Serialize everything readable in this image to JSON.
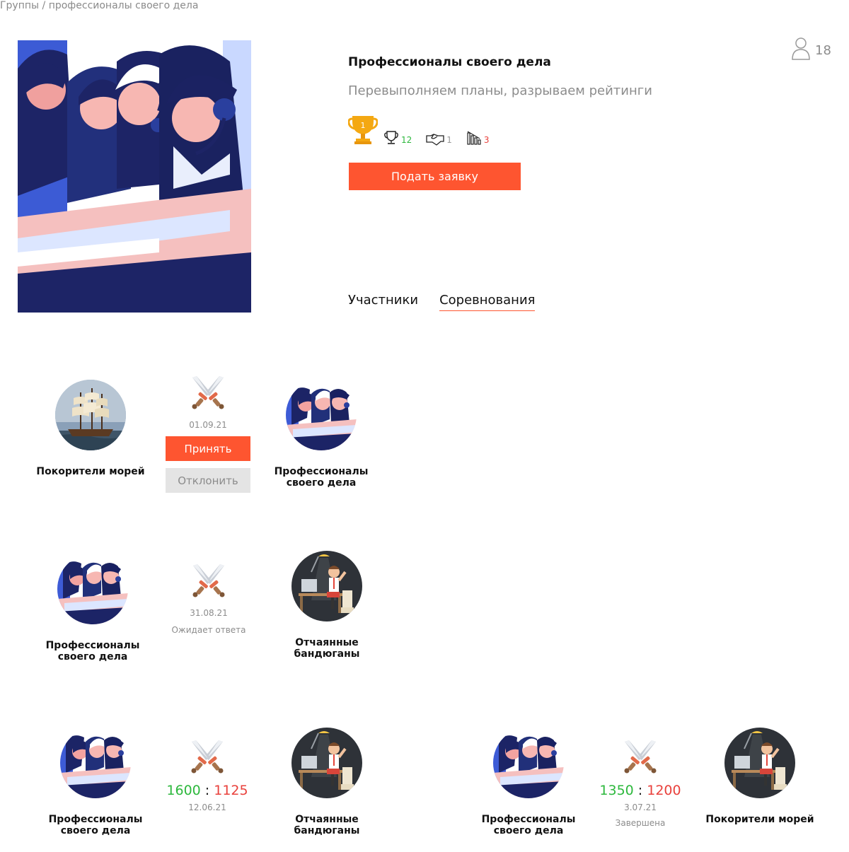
{
  "breadcrumb": "Группы / профессионалы своего дела",
  "group": {
    "title": "Профессионалы своего дела",
    "subtitle": "Перевыполняем планы, разрываем рейтинги",
    "members_count": "18",
    "rank_badge": "1",
    "wins": "12",
    "draws": "1",
    "losses": "3",
    "apply_label": "Подать заявку"
  },
  "tabs": [
    {
      "label": "Участники",
      "active": false
    },
    {
      "label": "Соревнования",
      "active": true
    }
  ],
  "colors": {
    "accent": "#fe5530",
    "win": "#2db83d",
    "loss": "#e9413c",
    "muted": "#8c8c8c"
  },
  "matches": [
    {
      "home": "Покорители морей",
      "away": "Профессионалы своего дела",
      "date": "01.09.21",
      "accept_label": "Принять",
      "decline_label": "Отклонить"
    },
    {
      "home": "Профессионалы своего дела",
      "away": "Отчаянные бандюганы",
      "date": "31.08.21",
      "status": "Ожидает ответа"
    },
    {
      "home": "Профессионалы своего дела",
      "away": "Отчаянные бандюганы",
      "score_home": "1600",
      "score_sep": ":",
      "score_away": "1125",
      "date": "12.06.21"
    },
    {
      "home": "Профессионалы своего дела",
      "away": "Покорители морей",
      "score_home": "1350",
      "score_sep": ":",
      "score_away": "1200",
      "date": "3.07.21",
      "status": "Завершена"
    }
  ]
}
